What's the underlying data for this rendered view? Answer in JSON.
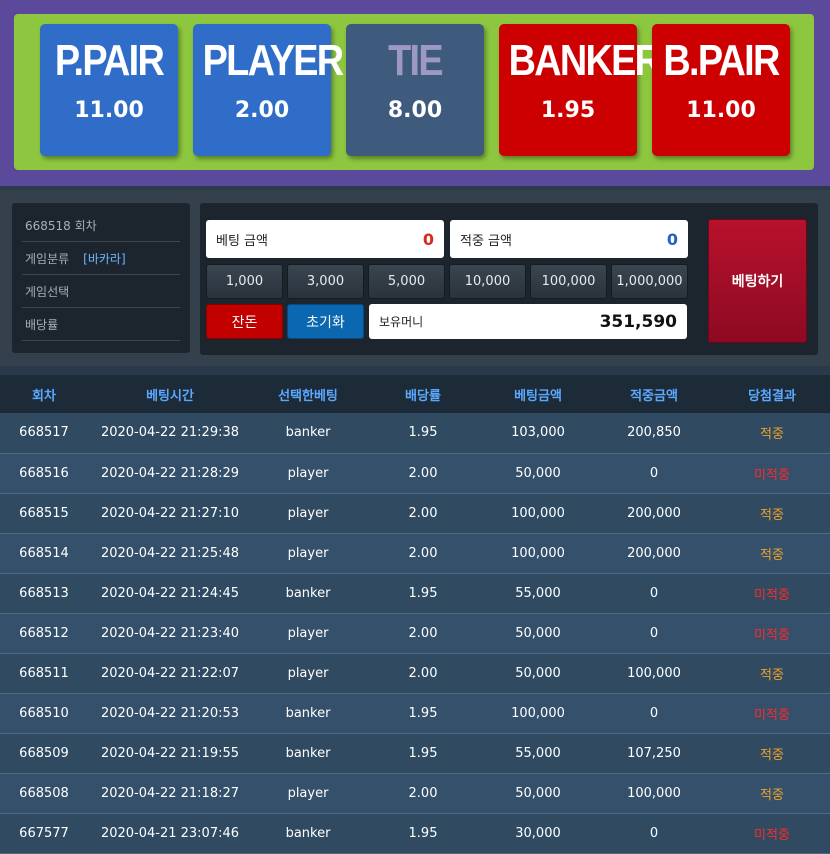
{
  "bet_options": [
    {
      "name": "P.PAIR",
      "odds": "11.00"
    },
    {
      "name": "PLAYER",
      "odds": "2.00"
    },
    {
      "name": "TIE",
      "odds": "8.00"
    },
    {
      "name": "BANKER",
      "odds": "1.95"
    },
    {
      "name": "B.PAIR",
      "odds": "11.00"
    }
  ],
  "colors": {
    "blue": "#2f6dc8",
    "tie": "#3e5a7c",
    "red": "#cc0000",
    "board": "#8dc63f",
    "frame": "#5b4a9c"
  },
  "info": {
    "round": "668518 회차",
    "category_label": "게임분류",
    "category_value": "[바카라]",
    "game_select_label": "게임선택",
    "odds_label": "배당률"
  },
  "betting": {
    "bet_amount_label": "베팅 금액",
    "bet_amount_value": "0",
    "win_amount_label": "적중 금액",
    "win_amount_value": "0",
    "chips": [
      "1,000",
      "3,000",
      "5,000",
      "10,000",
      "100,000",
      "1,000,000"
    ],
    "clear_label": "잔돈",
    "reset_label": "초기화",
    "money_label": "보유머니",
    "money_value": "351,590",
    "submit_label": "베팅하기"
  },
  "history": {
    "headers": [
      "회차",
      "베팅시간",
      "선택한베팅",
      "배당률",
      "베팅금액",
      "적중금액",
      "당첨결과"
    ],
    "rows": [
      {
        "round": "668517",
        "time": "2020-04-22 21:29:38",
        "pick": "banker",
        "odds": "1.95",
        "bet": "103,000",
        "win": "200,850",
        "result": "적중"
      },
      {
        "round": "668516",
        "time": "2020-04-22 21:28:29",
        "pick": "player",
        "odds": "2.00",
        "bet": "50,000",
        "win": "0",
        "result": "미적중"
      },
      {
        "round": "668515",
        "time": "2020-04-22 21:27:10",
        "pick": "player",
        "odds": "2.00",
        "bet": "100,000",
        "win": "200,000",
        "result": "적중"
      },
      {
        "round": "668514",
        "time": "2020-04-22 21:25:48",
        "pick": "player",
        "odds": "2.00",
        "bet": "100,000",
        "win": "200,000",
        "result": "적중"
      },
      {
        "round": "668513",
        "time": "2020-04-22 21:24:45",
        "pick": "banker",
        "odds": "1.95",
        "bet": "55,000",
        "win": "0",
        "result": "미적중"
      },
      {
        "round": "668512",
        "time": "2020-04-22 21:23:40",
        "pick": "player",
        "odds": "2.00",
        "bet": "50,000",
        "win": "0",
        "result": "미적중"
      },
      {
        "round": "668511",
        "time": "2020-04-22 21:22:07",
        "pick": "player",
        "odds": "2.00",
        "bet": "50,000",
        "win": "100,000",
        "result": "적중"
      },
      {
        "round": "668510",
        "time": "2020-04-22 21:20:53",
        "pick": "banker",
        "odds": "1.95",
        "bet": "100,000",
        "win": "0",
        "result": "미적중"
      },
      {
        "round": "668509",
        "time": "2020-04-22 21:19:55",
        "pick": "banker",
        "odds": "1.95",
        "bet": "55,000",
        "win": "107,250",
        "result": "적중"
      },
      {
        "round": "668508",
        "time": "2020-04-22 21:18:27",
        "pick": "player",
        "odds": "2.00",
        "bet": "50,000",
        "win": "100,000",
        "result": "적중"
      },
      {
        "round": "667577",
        "time": "2020-04-21 23:07:46",
        "pick": "banker",
        "odds": "1.95",
        "bet": "30,000",
        "win": "0",
        "result": "미적중"
      }
    ]
  }
}
